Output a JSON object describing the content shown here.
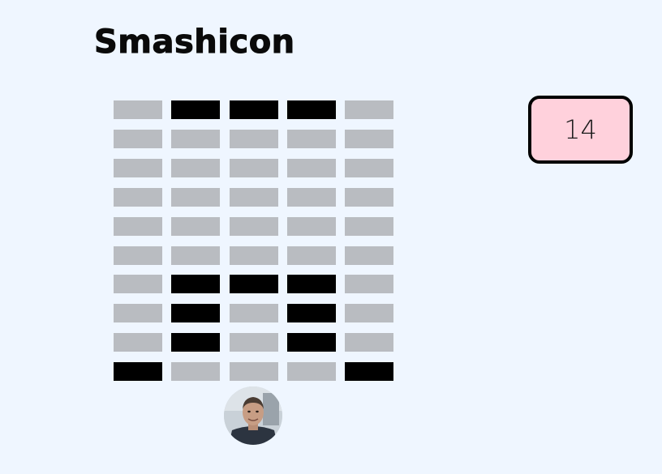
{
  "app": {
    "logo_text": "Smashicon"
  },
  "score": {
    "value": "14"
  },
  "grid": {
    "columns": 5,
    "rows": [
      [
        0,
        1,
        1,
        1,
        0
      ],
      [
        0,
        0,
        0,
        0,
        0
      ],
      [
        0,
        0,
        0,
        0,
        0
      ],
      [
        0,
        0,
        0,
        0,
        0
      ],
      [
        0,
        0,
        0,
        0,
        0
      ],
      [
        0,
        0,
        0,
        0,
        0
      ],
      [
        0,
        1,
        1,
        1,
        0
      ],
      [
        0,
        1,
        0,
        1,
        0
      ],
      [
        0,
        1,
        0,
        1,
        0
      ],
      [
        1,
        0,
        0,
        0,
        1
      ]
    ],
    "colors": {
      "empty": "#b9bcc1",
      "filled": "#000000"
    }
  },
  "avatar": {
    "icon": "user-avatar-photo"
  },
  "colors": {
    "background": "#eff6ff",
    "score_box": "#ffd1dc",
    "text": "#0a0a0a"
  }
}
